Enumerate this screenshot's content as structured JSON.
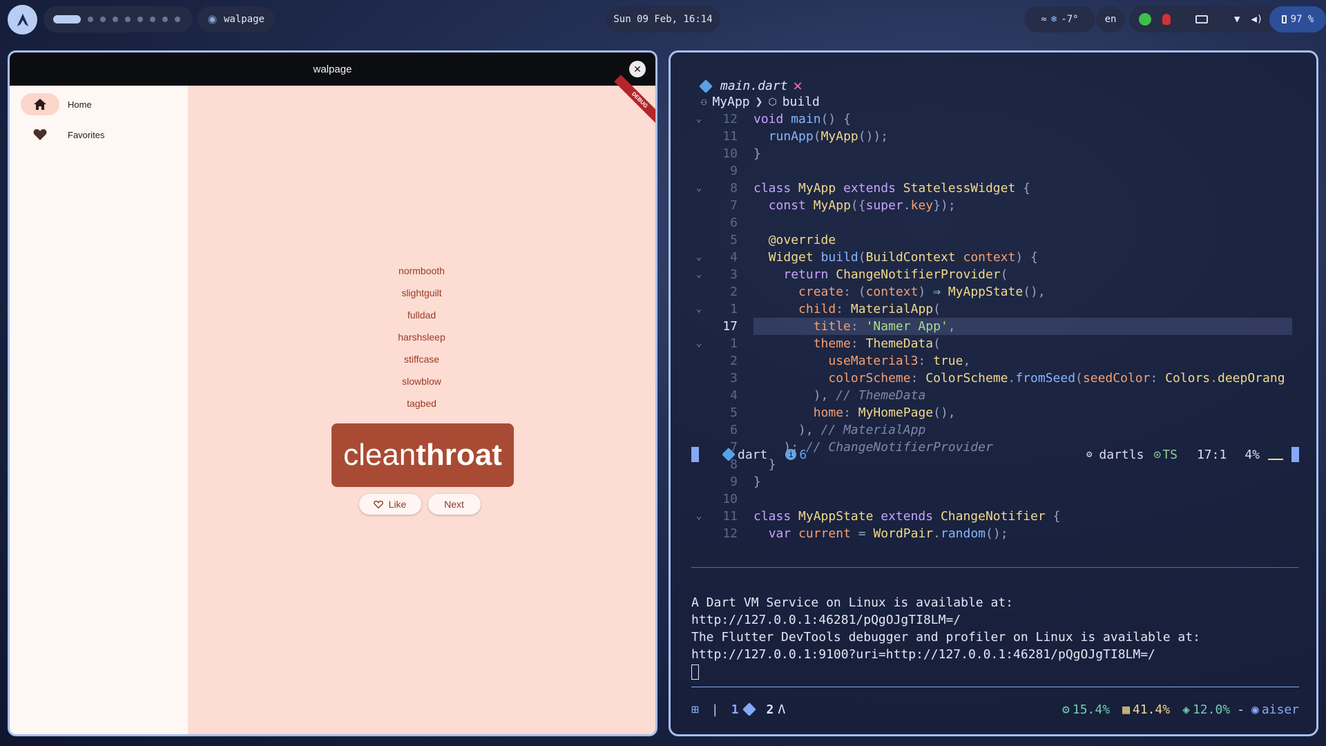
{
  "topbar": {
    "active_app": "walpage",
    "clock": "Sun 09 Feb, 16:14",
    "weather": "-7°",
    "language": "en",
    "battery": "97 %"
  },
  "flutter_window": {
    "title": "walpage",
    "debug_banner": "DEBUG",
    "nav": [
      {
        "label": "Home",
        "icon": "home-icon",
        "selected": true
      },
      {
        "label": "Favorites",
        "icon": "heart-icon",
        "selected": false
      }
    ],
    "history": [
      "normbooth",
      "slightguilt",
      "fulldad",
      "harshsleep",
      "stiffcase",
      "slowblow",
      "tagbed"
    ],
    "pair": {
      "first": "clean",
      "second": "throat"
    },
    "like_label": "Like",
    "next_label": "Next",
    "colors": {
      "primary": "#a94b34",
      "surface": "#fcdcd3",
      "rail": "#fff7f4"
    }
  },
  "editor": {
    "file": "main.dart",
    "breadcrumb": [
      "MyApp",
      "build"
    ],
    "lines": [
      {
        "fold": "⌄",
        "ln": "12"
      },
      {
        "fold": "",
        "ln": "11"
      },
      {
        "fold": "",
        "ln": "10"
      },
      {
        "fold": "",
        "ln": "9"
      },
      {
        "fold": "⌄",
        "ln": "8"
      },
      {
        "fold": "",
        "ln": "7"
      },
      {
        "fold": "",
        "ln": "6"
      },
      {
        "fold": "",
        "ln": "5"
      },
      {
        "fold": "⌄",
        "ln": "4"
      },
      {
        "fold": "⌄",
        "ln": "3"
      },
      {
        "fold": "",
        "ln": "2"
      },
      {
        "fold": "⌄",
        "ln": "1"
      },
      {
        "fold": "",
        "ln": "17"
      },
      {
        "fold": "⌄",
        "ln": "1"
      },
      {
        "fold": "",
        "ln": "2"
      },
      {
        "fold": "",
        "ln": "3"
      },
      {
        "fold": "",
        "ln": "4"
      },
      {
        "fold": "",
        "ln": "5"
      },
      {
        "fold": "",
        "ln": "6"
      },
      {
        "fold": "",
        "ln": "7"
      },
      {
        "fold": "",
        "ln": "8"
      },
      {
        "fold": "",
        "ln": "9"
      },
      {
        "fold": "",
        "ln": "10"
      },
      {
        "fold": "⌄",
        "ln": "11"
      },
      {
        "fold": "",
        "ln": "12"
      }
    ],
    "status": {
      "filetype": "dart",
      "diagnostics": "6",
      "lsp": "dartls",
      "treesitter": "TS",
      "position": "17:1",
      "percent": "4%"
    }
  },
  "terminal": {
    "output": [
      "A Dart VM Service on Linux is available at:",
      "http://127.0.0.1:46281/pQgOJgTI8LM=/",
      "The Flutter DevTools debugger and profiler on Linux is available at:",
      "http://127.0.0.1:9100?uri=http://127.0.0.1:46281/pQgOJgTI8LM=/"
    ]
  },
  "tmux": {
    "window1": "1",
    "window2": "2",
    "cpu": "15.4%",
    "mem": "41.4%",
    "disk": "12.0%",
    "separator": "-",
    "user": "aiser"
  }
}
